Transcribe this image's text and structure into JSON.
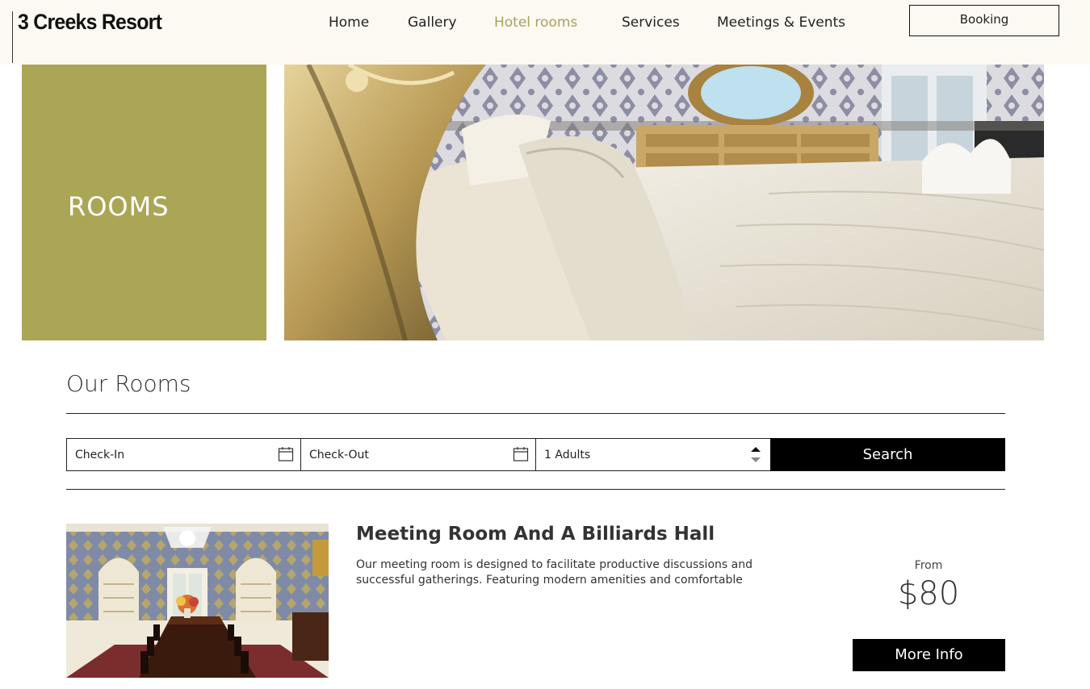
{
  "header": {
    "logo": "3 Creeks Resort",
    "nav": [
      {
        "label": "Home"
      },
      {
        "label": "Gallery"
      },
      {
        "label": "Hotel rooms",
        "active": true
      },
      {
        "label": "Services"
      },
      {
        "label": "Meetings & Events"
      }
    ],
    "booking_label": "Booking",
    "accent_color": "#a8a260"
  },
  "hero": {
    "title": "ROOMS",
    "block_color": "#aba656",
    "image": "ornate-bed-photo"
  },
  "rooms_section": {
    "title": "Our Rooms",
    "search": {
      "checkin_label": "Check-In",
      "checkout_label": "Check-Out",
      "guests_label": "1 Adults",
      "button_label": "Search"
    },
    "rooms": [
      {
        "name": "Meeting Room And A Billiards Hall",
        "description": "Our meeting room is designed to facilitate productive discussions and successful gatherings. Featuring modern amenities and comfortable",
        "from_label": "From",
        "price": "$80",
        "more_label": "More Info",
        "image": "dining-room-photo"
      }
    ]
  }
}
